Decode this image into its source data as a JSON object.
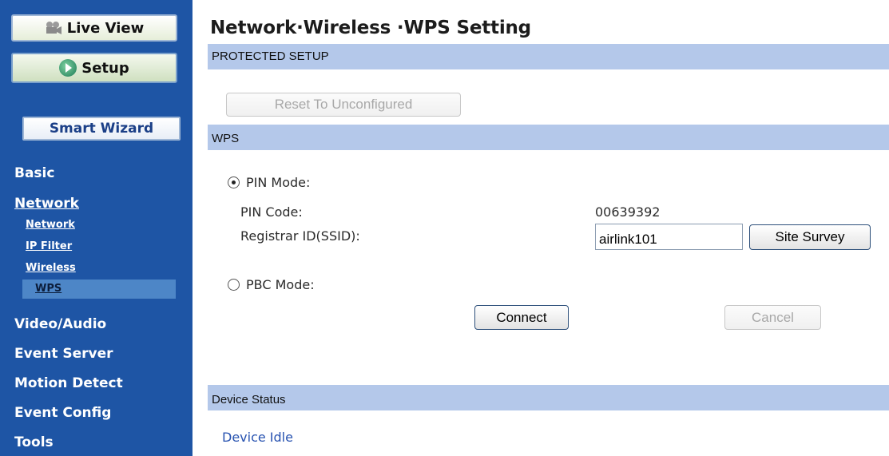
{
  "sidebar": {
    "live_view_label": "Live View",
    "setup_label": "Setup",
    "smart_wizard_label": "Smart Wizard",
    "nav": {
      "basic": "Basic",
      "network": "Network",
      "network_sub": [
        "Network",
        "IP Filter",
        "Wireless",
        "WPS"
      ],
      "video_audio": "Video/Audio",
      "event_server": "Event Server",
      "motion_detect": "Motion Detect",
      "event_config": "Event Config",
      "tools": "Tools"
    }
  },
  "main": {
    "title": "Network·Wireless ·WPS Setting",
    "protected_setup": {
      "heading": "PROTECTED SETUP",
      "reset_label": "Reset To Unconfigured"
    },
    "wps": {
      "heading": "WPS",
      "pin_mode_label": "PIN Mode:",
      "pin_mode_selected": true,
      "pin_code_label": "PIN Code:",
      "pin_code_value": "00639392",
      "registrar_label": "Registrar ID(SSID):",
      "ssid_value": "airlink101",
      "site_survey_label": "Site Survey",
      "pbc_mode_label": "PBC Mode:",
      "connect_label": "Connect",
      "cancel_label": "Cancel"
    },
    "device_status": {
      "heading": "Device Status",
      "text": "Device Idle"
    }
  },
  "colors": {
    "sidebar_bg": "#1e55a5",
    "band_bg": "#b4c8ea",
    "selected_nav_bg": "#4d86c7",
    "status_text": "#2752b0"
  },
  "icons": {
    "live_view": "video-camera-icon",
    "setup": "setup-arrow-icon",
    "radio_checked": "radio-checked-icon",
    "radio_unchecked": "radio-unchecked-icon"
  }
}
